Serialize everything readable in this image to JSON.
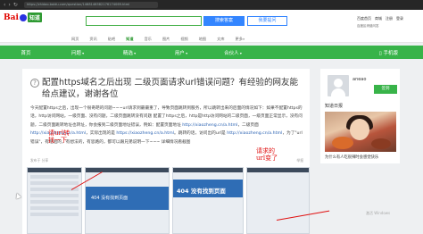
{
  "browser": {
    "url": "https://zhidao.baidu.com/question/1468146582176174069.html"
  },
  "header": {
    "logo_text": "Bai",
    "logo_badge": "知道",
    "search_button": "搜索答案",
    "ask_button": "我要提问",
    "top_links": [
      "百度首页",
      "商城",
      "注册",
      "登录"
    ],
    "top_sub": "百度区块链问答"
  },
  "subnav": [
    "网页",
    "资讯",
    "贴吧",
    "知道",
    "音乐",
    "图片",
    "视频",
    "地图",
    "文库",
    "更多»"
  ],
  "greenbar": {
    "items": [
      "首页",
      "问题",
      "精选",
      "用户",
      "合伙人"
    ],
    "mobile": "手机版"
  },
  "question": {
    "title": "配置https域名之后出现 二级页面请求url错误问题？有经验的网友能给点建议，谢谢各位",
    "body_parts": [
      {
        "t": "今天配置https之后，出现一个很奇葩的问题~~~url请求到最最重了，导致页面跳转到服务，所以跳转出来的后面的情况如下：如果不配置https的话，http访问网站，一级页面、没有问题，二级页面跳转没有问题 配置了https之后，http是http访问网站的二级页面，一级页面正常显示，没有问题，二级页面跳转地址也转址，你会报到二级页面地址错误，例如：配置页面地址 "
      },
      {
        "t": "http://xiaozheng.cn/a.html",
        "link": true
      },
      {
        "t": "，二级页面 "
      },
      {
        "t": "http://xiaozheng.cn/a.html",
        "link": true
      },
      {
        "t": "，实际出现的是 "
      },
      {
        "t": "https://xiaozheng.cn/a.html",
        "link": true
      },
      {
        "t": "。跳转的话，访问出的url是 "
      },
      {
        "t": "http://xiaozheng.cn/a.html",
        "link": true
      },
      {
        "t": "，为了\"url错误\"，有经验的，有想法的，有思路的，都可以跟兄弟说明一下~~~ 详细情况看截图"
      }
    ],
    "meta_left": "发布于 分享",
    "meta_right": "举报"
  },
  "screenshots": {
    "note1": "请url转找一下",
    "shot2_text": "404 没有找到页面",
    "shot3_text": "404 没有找到页面",
    "note2": "请求的url变了",
    "watermark": "激活 Windows"
  },
  "sidebar": {
    "username": "aneao",
    "user_meta": "",
    "signin_button": "签到",
    "daily_title": "知道日报",
    "daily_caption": "为什么有人吃很辣时会感觉快乐"
  }
}
